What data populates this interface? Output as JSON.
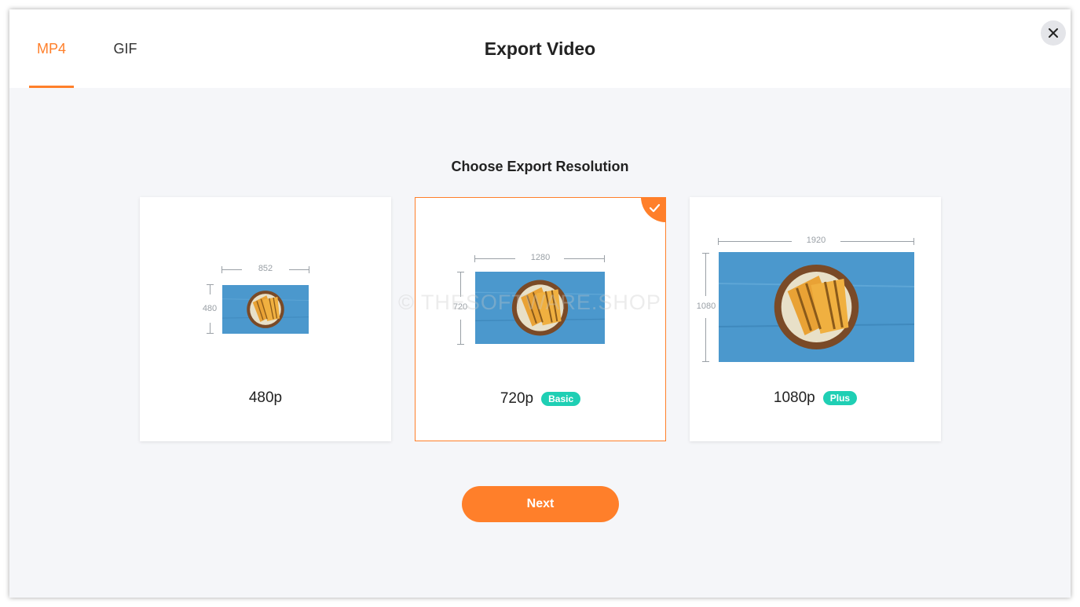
{
  "header": {
    "tabs": [
      {
        "label": "MP4",
        "active": true
      },
      {
        "label": "GIF",
        "active": false
      }
    ],
    "title": "Export Video",
    "close_icon": "close-icon"
  },
  "main": {
    "section_title": "Choose Export Resolution",
    "options": [
      {
        "label": "480p",
        "width": "852",
        "height": "480",
        "badge": "",
        "selected": false
      },
      {
        "label": "720p",
        "width": "1280",
        "height": "720",
        "badge": "Basic",
        "selected": true
      },
      {
        "label": "1080p",
        "width": "1920",
        "height": "1080",
        "badge": "Plus",
        "selected": false
      }
    ],
    "next_label": "Next"
  },
  "watermark": "© THESOFTWARE.SHOP",
  "colors": {
    "accent": "#ff7f2a",
    "badge": "#1fcfb4",
    "background": "#f5f6f9"
  }
}
